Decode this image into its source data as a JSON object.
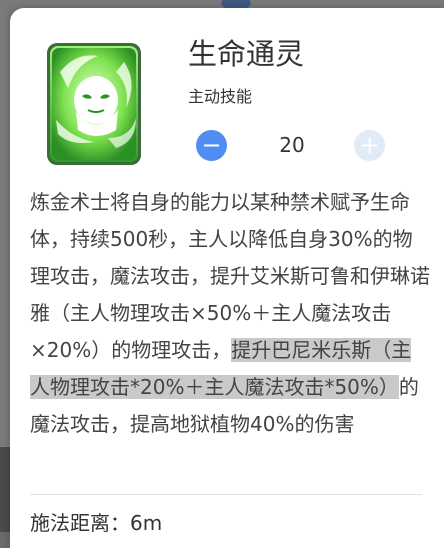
{
  "skill": {
    "name": "生命通灵",
    "type": "主动技能",
    "level": "20",
    "minus_icon": "minus-icon",
    "plus_icon": "plus-icon",
    "description_before": "炼金术士将自身的能力以某种禁术赋予生命体，持续500秒，主人以降低自身30%的物理攻击，魔法攻击，提升艾米斯可鲁和伊琳诺雅（主人物理攻击×50%＋主人魔法攻击×20%）的物理攻击，",
    "description_highlight": "提升巴尼米乐斯（主人物理攻击*20%＋主人魔法攻击*50%）",
    "description_after": "的魔法攻击，提高地狱植物40%的伤害",
    "range_label": "施法距离：6m"
  },
  "colors": {
    "accent": "#4f8df1",
    "disabled": "#e1ebf8",
    "highlight": "#c9c9c9",
    "icon_green": "#53d33a"
  }
}
